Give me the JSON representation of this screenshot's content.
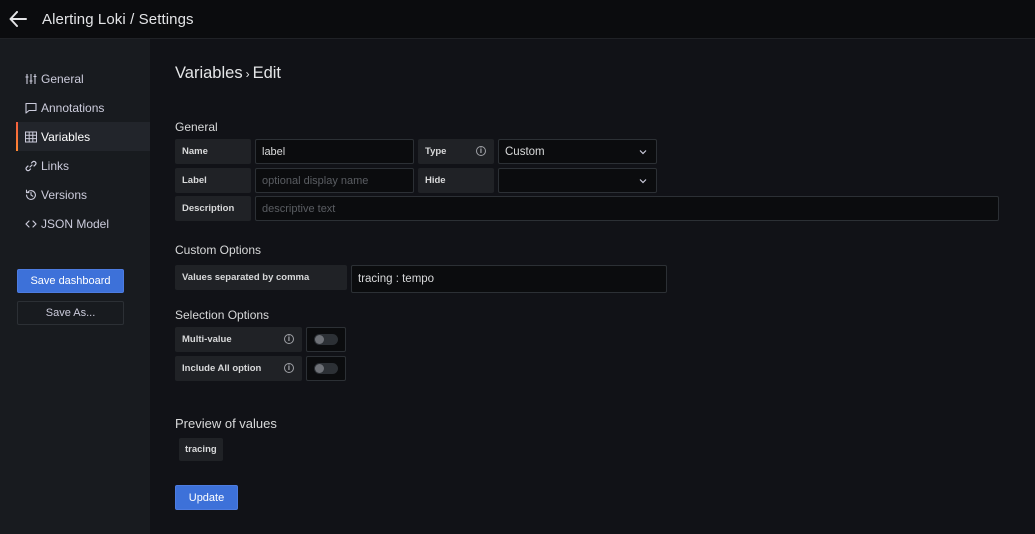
{
  "header": {
    "title": "Alerting Loki / Settings",
    "back_icon": "arrow-left-icon"
  },
  "sidebar": {
    "items": [
      {
        "label": "General",
        "icon": "sliders-icon",
        "active": false
      },
      {
        "label": "Annotations",
        "icon": "comment-icon",
        "active": false
      },
      {
        "label": "Variables",
        "icon": "calculator-icon",
        "active": true
      },
      {
        "label": "Links",
        "icon": "link-icon",
        "active": false
      },
      {
        "label": "Versions",
        "icon": "history-icon",
        "active": false
      },
      {
        "label": "JSON Model",
        "icon": "code-icon",
        "active": false
      }
    ],
    "save_label": "Save dashboard",
    "save_as_label": "Save As..."
  },
  "page": {
    "title_main": "Variables",
    "title_sep": "›",
    "title_sub": "Edit"
  },
  "general": {
    "title": "General",
    "name_label": "Name",
    "name_value": "label",
    "type_label": "Type",
    "type_value": "Custom",
    "label_label": "Label",
    "label_placeholder": "optional display name",
    "hide_label": "Hide",
    "hide_value": "",
    "description_label": "Description",
    "description_placeholder": "descriptive text"
  },
  "custom_options": {
    "title": "Custom Options",
    "values_label": "Values separated by comma",
    "values_value": "tracing : tempo"
  },
  "selection_options": {
    "title": "Selection Options",
    "multi_value_label": "Multi-value",
    "multi_value_on": false,
    "include_all_label": "Include All option",
    "include_all_on": false
  },
  "preview": {
    "title": "Preview of values",
    "values": [
      "tracing"
    ]
  },
  "update_label": "Update",
  "colors": {
    "primary": "#3d71d9",
    "active_accent": "#f55f3e",
    "background": "#111217",
    "sidebar": "#181b1f"
  }
}
